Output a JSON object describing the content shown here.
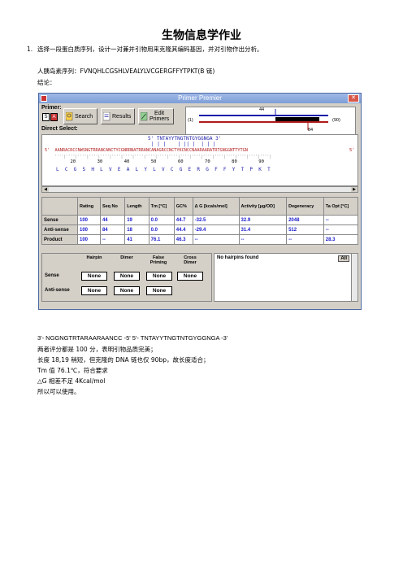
{
  "page": {
    "title": "生物信息学作业",
    "question_number": "1.",
    "question": "选择一段蛋白质序列，设计一对兼并引物用来克隆其编码基因，并对引物作出分析。",
    "sequence_line": "人胰岛素序列：FVNQHLCGSHLVEALYLVCGERGFFYTPKT(B 链)",
    "conclusion_label": "结论：",
    "primers_line": "3'- NGGNGTRTARAARAANCC -5'        5'- TNTAYYTNGTNTGYGGNGA -3'",
    "notes": [
      "两者评分都是 100 分，表明引物品质完美；",
      "长度 18,19 稍短，但克隆的 DNA 链也仅 90bp，故长度适合；",
      "Tm 值 76.1℃，符合要求",
      "△G 相差不足 4Kcal/mol",
      "所以可以使用。"
    ]
  },
  "app": {
    "title": "Primer Premier",
    "primer_label": "Primer:",
    "sense_btn": "S",
    "antisense_btn": "A",
    "search": "Search",
    "results": "Results",
    "edit_primers_1": "Edit",
    "edit_primers_2": "Primers",
    "direct_select": "Direct Select:",
    "map_labels": {
      "top": "44",
      "left": "(1)",
      "right": "(90)",
      "bottom": "84"
    },
    "sense_primer": "5' TNTAYYTNGTNTGYGGNGA 3'",
    "ruler_bars": "| | |    | || |  | | |",
    "dna_line": "5'  AANRACRCCNWSNGTRRANCANCTYCGNRRNATRRANCANAGRCCNCTYKCNCCNAARAARATRTGNGGNTTYTGN",
    "dna_end": "5'",
    "ruler_nums": "        20        30        40        50        60        70        80        90",
    "aa_line": "L  C  G  S  H  L  V  E  A  L  Y  L  V  C  G  E  R  G  F  F  Y  T  P  K  T",
    "table_headers": [
      "",
      "Rating",
      "Seq No",
      "Length",
      "Tm [°C]",
      "GC%",
      "Δ G [kcals/mol]",
      "Activity [µg/OD]",
      "Degeneracy",
      "Ta Opt [°C]"
    ],
    "table_rows": [
      [
        "Sense",
        "100",
        "44",
        "19",
        "0.0",
        "44.7",
        "-32.5",
        "32.9",
        "2048",
        "--"
      ],
      [
        "Anti-sense",
        "100",
        "84",
        "18",
        "0.0",
        "44.4",
        "-29.4",
        "31.4",
        "512",
        "--"
      ],
      [
        "Product",
        "100",
        "--",
        "41",
        "76.1",
        "46.3",
        "--",
        "--",
        "--",
        "28.3"
      ]
    ],
    "check_headers": [
      "Hairpin",
      "Dimer",
      "False Priming",
      "Cross Dimer"
    ],
    "check_rows": [
      "Sense",
      "Anti-sense"
    ],
    "none": "None",
    "no_hairpins": "No hairpins found",
    "all": "All"
  }
}
